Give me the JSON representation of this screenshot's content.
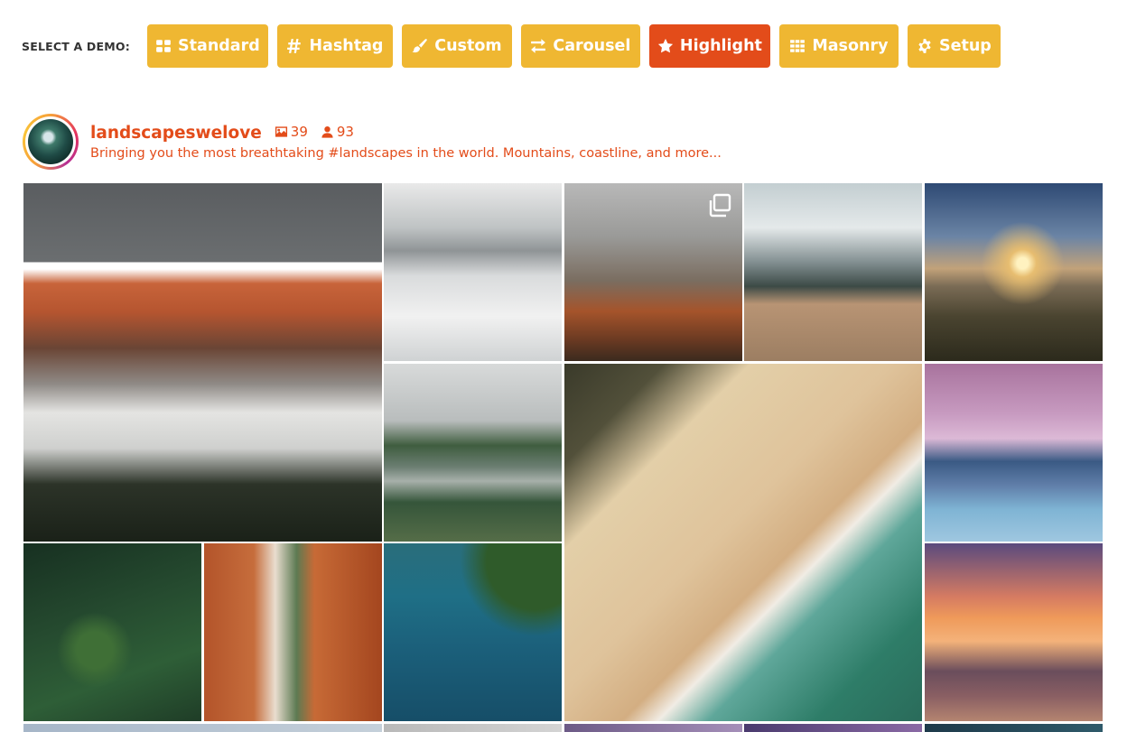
{
  "demo_selector": {
    "label": "SELECT A DEMO:",
    "buttons": [
      {
        "label": "Standard",
        "icon": "grid-icon",
        "active": false
      },
      {
        "label": "Hashtag",
        "icon": "hashtag-icon",
        "active": false
      },
      {
        "label": "Custom",
        "icon": "paintbrush-icon",
        "active": false
      },
      {
        "label": "Carousel",
        "icon": "exchange-icon",
        "active": false
      },
      {
        "label": "Highlight",
        "icon": "star-icon",
        "active": true
      },
      {
        "label": "Masonry",
        "icon": "th-icon",
        "active": false
      },
      {
        "label": "Setup",
        "icon": "gear-icon",
        "active": false
      }
    ]
  },
  "profile": {
    "username": "landscapeswelove",
    "posts_count": "39",
    "followers_count": "93",
    "bio": "Bringing you the most breathtaking #landscapes in the world. Mountains, coastline, and more..."
  },
  "feed": {
    "posts": [
      {
        "subject": "snowy mountain ridge",
        "carousel": false
      },
      {
        "subject": "misty forest valley",
        "carousel": false
      },
      {
        "subject": "foggy autumn cabin",
        "carousel": true
      },
      {
        "subject": "mountain cabin meadow",
        "carousel": false
      },
      {
        "subject": "sunset above clouds",
        "carousel": false
      },
      {
        "subject": "river lake valley",
        "carousel": false
      },
      {
        "subject": "aerial beach",
        "carousel": false
      },
      {
        "subject": "volcano at dawn",
        "carousel": false
      },
      {
        "subject": "aerial forest",
        "carousel": false
      },
      {
        "subject": "red canyon",
        "carousel": false
      },
      {
        "subject": "aerial turquoise lake",
        "carousel": false
      },
      {
        "subject": "beach sunset",
        "carousel": false
      }
    ]
  },
  "colors": {
    "button_bg": "#efb732",
    "button_active_bg": "#e34c1a",
    "accent": "#e34c1a"
  }
}
